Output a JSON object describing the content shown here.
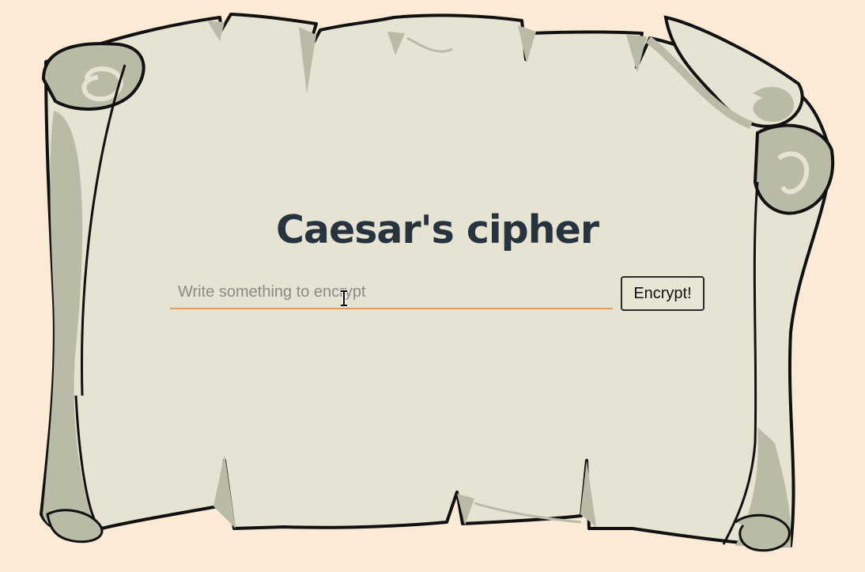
{
  "page": {
    "title": "Caesar's cipher"
  },
  "form": {
    "input_value": "",
    "input_placeholder": "Write something to encrypt",
    "encrypt_label": "Encrypt!"
  },
  "icons": {
    "cursor": "text-cursor-icon",
    "background": "parchment-scroll-icon"
  },
  "colors": {
    "page_background": "#fbead6",
    "parchment": "#e6e3d2",
    "parchment_shadow": "#b9bba6",
    "title_text": "#273440",
    "input_underline": "#e39a55"
  }
}
